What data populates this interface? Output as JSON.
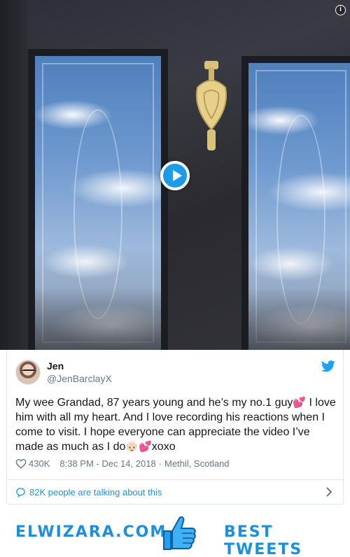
{
  "media": {
    "play_icon": "play-icon",
    "info_icon": "info-icon",
    "info_label": "i"
  },
  "tweet": {
    "author_name": "Jen",
    "author_handle": "@JenBarclayX",
    "text_part1": "My wee Grandad, 87 years young and he’s my no.1 guy",
    "emoji_heart": "💕",
    "text_part2": " I love him with all my heart. And I love recording his reactions when I come to visit. I hope everyone can appreciate the video I’ve made as much as I do",
    "emoji_face": "👴🏻",
    "emoji_heart2": "💕",
    "text_part3": "xoxo",
    "likes": "430K",
    "time": "8:38 PM - Dec 14, 2018",
    "separator": "·",
    "location": "Methil, Scotland",
    "talking_label": "82K people are talking about this"
  },
  "banner": {
    "brand": "ELWIZARA.COM",
    "tagline": "BEST TWEETS"
  },
  "colors": {
    "twitter_blue": "#1da1f2",
    "link_blue": "#1b95e0",
    "muted": "#657786",
    "heart": "#e0245e"
  }
}
